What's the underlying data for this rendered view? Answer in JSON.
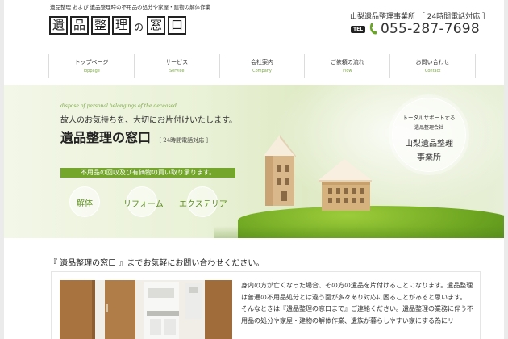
{
  "header": {
    "tagline": "遺品整理 および 遺品整理時の不用品の処分や家屋・建物の解体作業",
    "logo_chars": [
      "遺",
      "品",
      "整",
      "理",
      "の",
      "窓",
      "口"
    ],
    "company_name": "山梨遺品整理事業所 ［ 24時間電話対応 ］",
    "tel_badge": "TEL",
    "tel_number": "055-287-7698"
  },
  "nav": [
    {
      "jp": "トップページ",
      "en": "Toppage"
    },
    {
      "jp": "サービス",
      "en": "Service"
    },
    {
      "jp": "会社案内",
      "en": "Company"
    },
    {
      "jp": "ご依頼の流れ",
      "en": "Flow"
    },
    {
      "jp": "お問い合わせ",
      "en": "Contact"
    }
  ],
  "hero": {
    "english_line": "dispose of personal belongings of the deceased",
    "subtitle": "故人のお気持ちを、大切にお片付けいたします。",
    "title": "遺品整理の窓口",
    "title_note": "［ 24時間電話対応 ］",
    "bar_text": "不用品の回収及び有価物の買い取り承ります。",
    "services": [
      "解体",
      "リフォーム",
      "エクステリア"
    ],
    "badge": {
      "line1": "トータルサポートする",
      "line2": "遺品整理会社",
      "line3": "山梨遺品整理",
      "line4": "事業所"
    }
  },
  "contact": {
    "heading": "『 遺品整理の窓口 』までお気軽にお問い合わせください。",
    "paragraphs": [
      "身内の方が亡くなった場合、その方の遺品を片付けることになります。遺品整理は普通の不用品処分とは違う面が多々あり対応に困ることがあると思います。",
      "そんなときは『遺品整理の窓口まで』ご連絡ください。遺品整理の業務に伴う不用品の処分や家屋・建物の解体作業、遺族が暮らしやすい家にする為にリ"
    ]
  },
  "colors": {
    "accent_green": "#73a62b",
    "nav_en_green": "#7aa544"
  }
}
